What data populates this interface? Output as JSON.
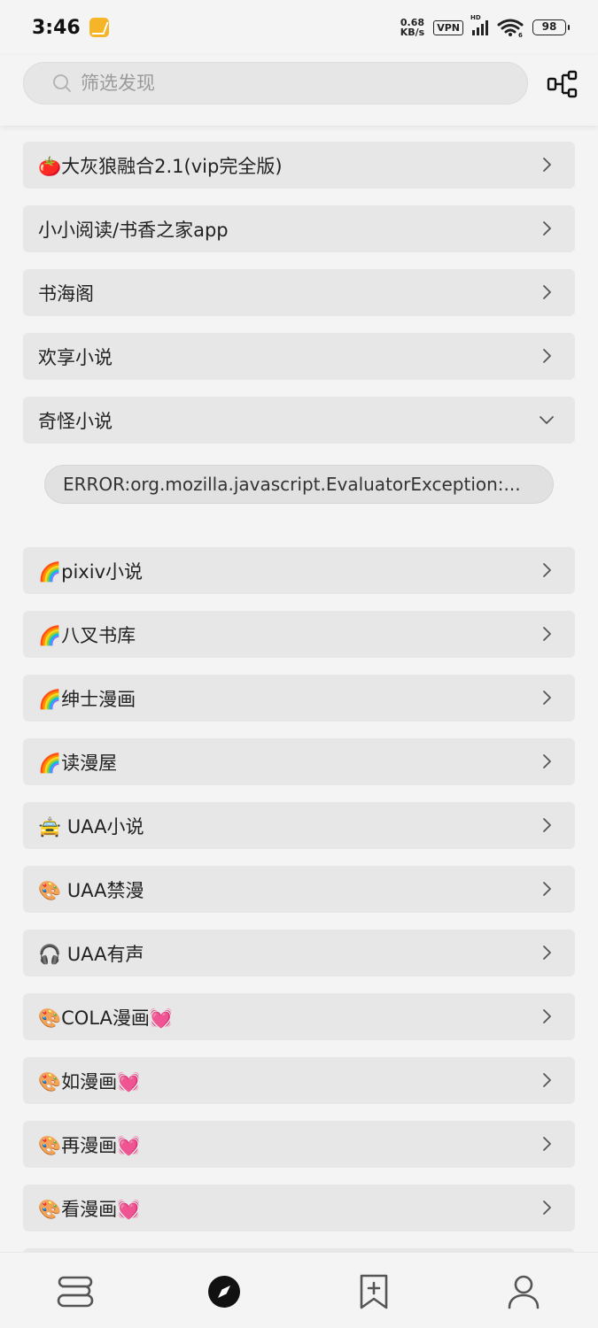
{
  "status_bar": {
    "time": "3:46",
    "net_speed_value": "0.68",
    "net_speed_unit": "KB/s",
    "vpn_label": "VPN",
    "hd_label": "HD",
    "wifi_label": "6",
    "battery": "98"
  },
  "search": {
    "placeholder": "筛选发现",
    "value": ""
  },
  "sources": [
    {
      "label": "🍅大灰狼融合2.1(vip完全版)",
      "expanded": false
    },
    {
      "label": "小小阅读/书香之家app",
      "expanded": false
    },
    {
      "label": "书海阁",
      "expanded": false
    },
    {
      "label": "欢享小说",
      "expanded": false
    },
    {
      "label": "奇怪小说",
      "expanded": true
    },
    {
      "label": "🌈pixiv小说",
      "expanded": false
    },
    {
      "label": "🌈八叉书库",
      "expanded": false
    },
    {
      "label": "🌈绅士漫画",
      "expanded": false
    },
    {
      "label": "🌈读漫屋",
      "expanded": false
    },
    {
      "label": "🚖 UAA小说",
      "expanded": false
    },
    {
      "label": "🎨 UAA禁漫",
      "expanded": false
    },
    {
      "label": "🎧 UAA有声",
      "expanded": false
    },
    {
      "label": "🎨COLA漫画💓",
      "expanded": false
    },
    {
      "label": "🎨如漫画💓",
      "expanded": false
    },
    {
      "label": "🎨再漫画💓",
      "expanded": false
    },
    {
      "label": "🎨看漫画💓",
      "expanded": false
    }
  ],
  "error_message": "ERROR:org.mozilla.javascript.EvaluatorException:...",
  "colors": {
    "background": "#f4f4f4",
    "item_background": "#e7e7e7",
    "text": "#222222",
    "accent": "#111111"
  },
  "bottom_nav": [
    {
      "name": "bookshelf",
      "icon": "bookshelf-icon",
      "active": false
    },
    {
      "name": "discover",
      "icon": "compass-icon",
      "active": true
    },
    {
      "name": "rss",
      "icon": "bookmark-add-icon",
      "active": false
    },
    {
      "name": "mine",
      "icon": "person-icon",
      "active": false
    }
  ]
}
